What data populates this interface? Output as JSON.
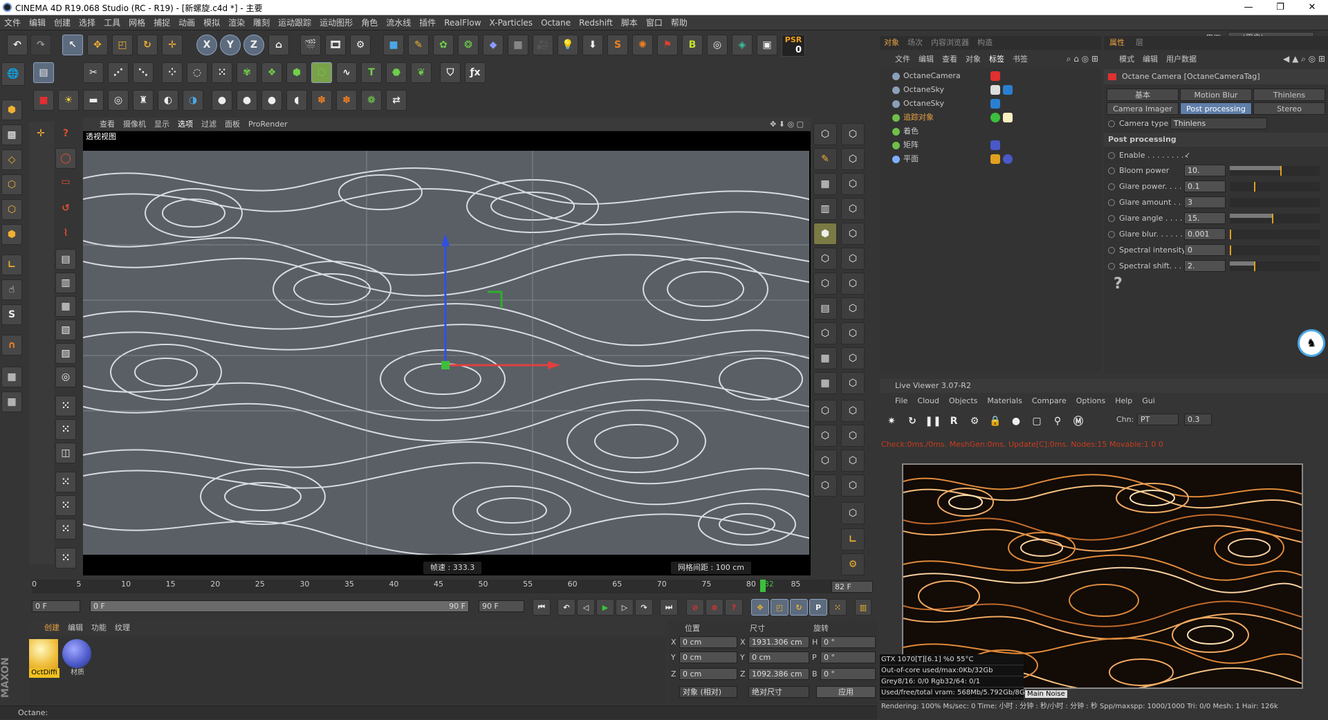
{
  "window": {
    "title": "CINEMA 4D R19.068 Studio (RC - R19) - [新螺旋.c4d *] - 主要",
    "min": "—",
    "max": "❐",
    "close": "✕"
  },
  "menu": [
    "文件",
    "编辑",
    "创建",
    "选择",
    "工具",
    "网格",
    "捕捉",
    "动画",
    "模拟",
    "渲染",
    "雕刻",
    "运动跟踪",
    "运动图形",
    "角色",
    "流水线",
    "插件",
    "RealFlow",
    "X-Particles",
    "Octane",
    "Redshift",
    "脚本",
    "窗口",
    "帮助"
  ],
  "interface": {
    "label": "界面:",
    "value": "oc (用户)"
  },
  "toolbar": {
    "psr": "PSR",
    "psr_val": "0",
    "x": "X",
    "y": "Y",
    "z": "Z"
  },
  "viewport": {
    "menu": [
      "查看",
      "摄像机",
      "显示",
      "选项",
      "过滤",
      "面板",
      "ProRender"
    ],
    "label": "透视视图",
    "speed": "帧速 : 333.3",
    "grid": "网格间距 : 100 cm"
  },
  "timeline": {
    "ticks": [
      "0",
      "5",
      "10",
      "15",
      "20",
      "25",
      "30",
      "35",
      "40",
      "45",
      "50",
      "55",
      "60",
      "65",
      "70",
      "75",
      "80",
      "82",
      "85",
      "90"
    ],
    "current_frame": 82,
    "end_display": "82 F",
    "start_field": "0 F",
    "range_start": "0 F",
    "range_end": "90 F",
    "end_field": "90 F"
  },
  "materials": {
    "menu": [
      "创建",
      "编辑",
      "功能",
      "纹理"
    ],
    "items": [
      {
        "name": "OctDiffi"
      },
      {
        "name": "材质"
      }
    ]
  },
  "coords": {
    "headers": [
      "位置",
      "尺寸",
      "旋转"
    ],
    "rows": [
      {
        "axis": "X",
        "pos": "0 cm",
        "size": "1931.306 cm",
        "rlabel": "H",
        "rot": "0 °"
      },
      {
        "axis": "Y",
        "pos": "0 cm",
        "size": "0 cm",
        "rlabel": "P",
        "rot": "0 °"
      },
      {
        "axis": "Z",
        "pos": "0 cm",
        "size": "1092.386 cm",
        "rlabel": "B",
        "rot": "0 °"
      }
    ],
    "mode": "对象 (相对)",
    "size_mode": "绝对尺寸",
    "apply": "应用"
  },
  "status": "Octane:",
  "objects_panel": {
    "tabs": [
      "对象",
      "场次",
      "内容浏览器",
      "构造"
    ],
    "menu": [
      "文件",
      "编辑",
      "查看",
      "对象",
      "标签",
      "书签"
    ],
    "items": [
      {
        "name": "OctaneCamera",
        "color": "#8aa0b8"
      },
      {
        "name": "OctaneSky",
        "color": "#8aa0b8"
      },
      {
        "name": "OctaneSky",
        "color": "#8aa0b8"
      },
      {
        "name": "追踪对象",
        "color": "#6fbf4a",
        "highlight": true
      },
      {
        "name": "着色",
        "color": "#6fbf4a"
      },
      {
        "name": "矩阵",
        "color": "#6fbf4a"
      },
      {
        "name": "平面",
        "color": "#7fb0ff"
      }
    ]
  },
  "attributes": {
    "tabs": [
      "属性",
      "层"
    ],
    "menu": [
      "模式",
      "编辑",
      "用户数据"
    ],
    "title": "Octane Camera [OctaneCameraTag]",
    "btns_row1": [
      "基本",
      "Motion Blur",
      "Thinlens"
    ],
    "btns_row2": [
      "Camera Imager",
      "Post processing",
      "Stereo"
    ],
    "camera_type_label": "Camera type",
    "camera_type": "Thinlens",
    "section": "Post processing",
    "enable_label": "Enable . . . . . . . . .",
    "enable_val": "✓",
    "params": [
      {
        "label": "Bloom power",
        "value": "10.",
        "fill": 0.56,
        "mark": 0.56
      },
      {
        "label": "Glare power. . . .",
        "value": "0.1",
        "fill": 0.0,
        "mark": 0.27
      },
      {
        "label": "Glare amount . . .",
        "value": "3",
        "fill": 0.0,
        "mark": -1
      },
      {
        "label": "Glare angle . . . .",
        "value": "15.",
        "fill": 0.47,
        "mark": 0.47
      },
      {
        "label": "Glare blur. . . . . .",
        "value": "0.001",
        "fill": 0.0,
        "mark": 0.0
      },
      {
        "label": "Spectral intensity",
        "value": "0",
        "fill": 0.0,
        "mark": 0.0
      },
      {
        "label": "Spectral shift. . . .",
        "value": "2.",
        "fill": 0.27,
        "mark": 0.27
      }
    ],
    "help": "?"
  },
  "live_viewer": {
    "title": "Live Viewer 3.07-R2",
    "menu": [
      "File",
      "Cloud",
      "Objects",
      "Materials",
      "Compare",
      "Options",
      "Help",
      "Gui"
    ],
    "chn_label": "Chn:",
    "chn": "PT",
    "chn_val": "0.3",
    "status": "Check:0ms./0ms. MeshGen:0ms. Update[C]:0ms. Nodes:15 Movable:1  0 0",
    "gpu": [
      "GTX 1070[T][6.1]          %0     55°C",
      "Out-of-core used/max:0Kb/32Gb",
      "Grey8/16: 0/0          Rgb32/64: 0/1",
      "Used/free/total vram: 568Mb/5.792Gb/8Gb"
    ],
    "gpu_tabs": "Main  Noise",
    "render_stats": "Rendering: 100%   Ms/sec: 0   Time: 小时 : 分钟 : 秒/小时 : 分钟 : 秒   Spp/maxspp: 1000/1000   Tri: 0/0   Mesh: 1   Hair: 126k"
  },
  "colors": {
    "accent": "#5f7ea8",
    "highlight": "#e8a040",
    "error": "#c83c1e"
  }
}
